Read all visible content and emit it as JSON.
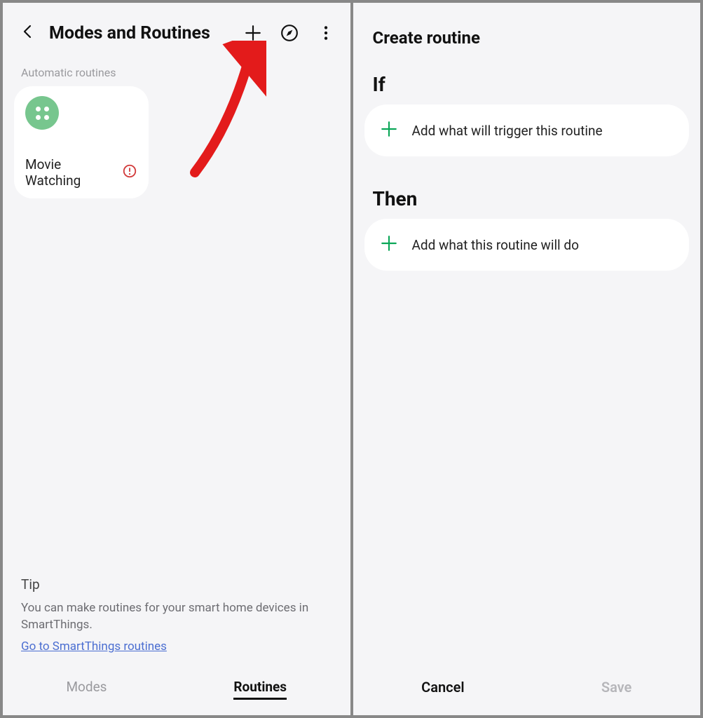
{
  "left": {
    "title": "Modes and Routines",
    "section_label": "Automatic routines",
    "routine": {
      "name": "Movie Watching"
    },
    "tip": {
      "heading": "Tip",
      "text": "You can make routines for your smart home devices in SmartThings.",
      "link": "Go to SmartThings routines"
    },
    "tabs": {
      "modes": "Modes",
      "routines": "Routines"
    }
  },
  "right": {
    "title": "Create routine",
    "if_label": "If",
    "if_action": "Add what will trigger this routine",
    "then_label": "Then",
    "then_action": "Add what this routine will do",
    "cancel": "Cancel",
    "save": "Save"
  },
  "colors": {
    "accent_green": "#0aa657",
    "arrow_red": "#e31b1b"
  }
}
